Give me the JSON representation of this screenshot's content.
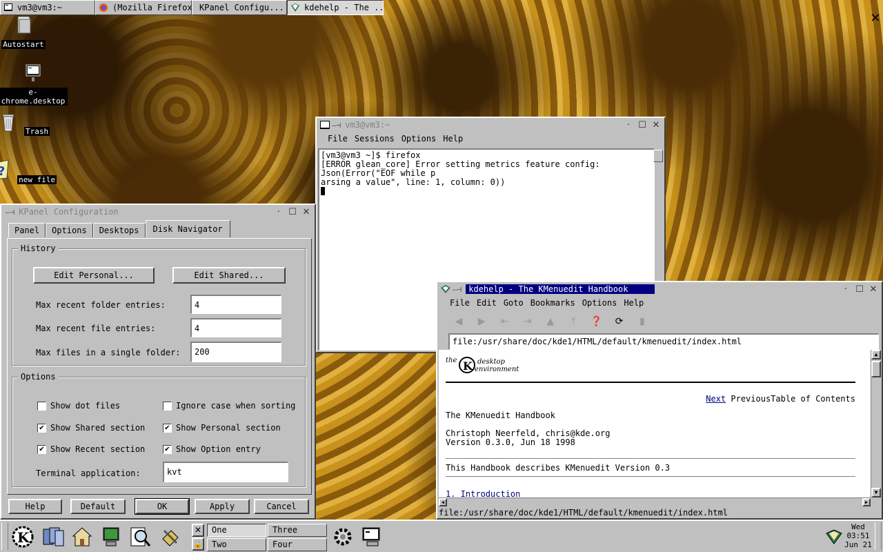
{
  "taskbar": {
    "tasks": [
      {
        "label": "vm3@vm3:~",
        "icon": "terminal-icon"
      },
      {
        "label": "(Mozilla Firefox)",
        "icon": "firefox-icon"
      },
      {
        "label": "KPanel Configu...",
        "icon": "none"
      },
      {
        "label": "kdehelp - The ...",
        "icon": "book-icon"
      }
    ]
  },
  "desktop": {
    "icons": [
      {
        "label": "Autostart",
        "icon": "folder-icon"
      },
      {
        "label": "e-chrome.desktop",
        "icon": "terminal-icon"
      },
      {
        "label": "Trash",
        "icon": "trash-icon"
      },
      {
        "label": "new file",
        "icon": "unknown-file-icon"
      }
    ]
  },
  "terminal": {
    "title": "vm3@vm3:~",
    "menu": [
      "File",
      "Sessions",
      "Options",
      "Help"
    ],
    "lines": [
      "[vm3@vm3 ~]$ firefox",
      "[ERROR glean_core] Error setting metrics feature config: Json(Error(\"EOF while p",
      "arsing a value\", line: 1, column: 0))"
    ]
  },
  "kpanel": {
    "title": "KPanel Configuration",
    "tabs": [
      "Panel",
      "Options",
      "Desktops",
      "Disk Navigator"
    ],
    "history_label": "History",
    "edit_personal": "Edit Personal...",
    "edit_shared": "Edit Shared...",
    "max_folder_label": "Max recent folder entries:",
    "max_folder_value": "4",
    "max_file_label": "Max recent file entries:",
    "max_file_value": "4",
    "max_single_label": "Max files in a single folder:",
    "max_single_value": "200",
    "options_label": "Options",
    "options": [
      {
        "label": "Show dot files",
        "checked": false
      },
      {
        "label": "Ignore case when sorting",
        "checked": false
      },
      {
        "label": "Show Shared section",
        "checked": true
      },
      {
        "label": "Show Personal section",
        "checked": true
      },
      {
        "label": "Show Recent section",
        "checked": true
      },
      {
        "label": "Show Option entry",
        "checked": true
      }
    ],
    "terminal_label": "Terminal application:",
    "terminal_value": "kvt",
    "buttons": [
      "Help",
      "Default",
      "OK",
      "Apply",
      "Cancel"
    ]
  },
  "kdehelp": {
    "title": "kdehelp - The KMenuedit Handbook",
    "menu": [
      "File",
      "Edit",
      "Goto",
      "Bookmarks",
      "Options",
      "Help"
    ],
    "url": "file:/usr/share/doc/kde1/HTML/default/kmenuedit/index.html",
    "logo_text_1": "the",
    "logo_text_2": "desktop",
    "logo_text_3": "environment",
    "nav_next": "Next",
    "nav_rest": " PreviousTable of Contents",
    "doc_title": "The KMenuedit Handbook",
    "author": "Christoph Neerfeld, chris@kde.org",
    "version": "Version 0.3.0, Jun 18 1998",
    "desc": "This Handbook describes KMenuedit Version 0.3",
    "toc_first": "1. Introduction",
    "status": "file:/usr/share/doc/kde1/HTML/default/kmenuedit/index.html"
  },
  "panel": {
    "desktops": [
      "One",
      "Three",
      "Two",
      "Four"
    ],
    "clock_day": "Wed",
    "clock_time": "03:51",
    "clock_date": "Jun 21"
  }
}
